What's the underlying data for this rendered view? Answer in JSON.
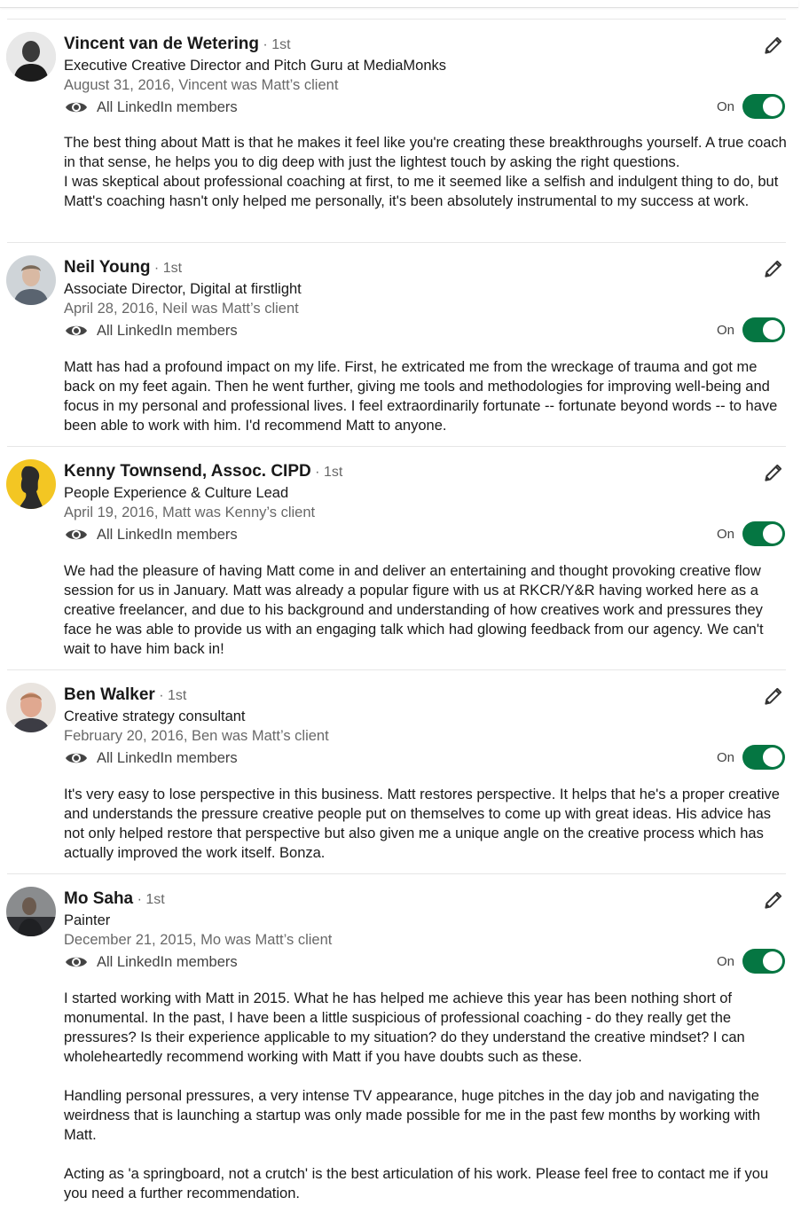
{
  "recommendations": [
    {
      "name": "Vincent van de Wetering",
      "degree": "· 1st",
      "headline": "Executive Creative Director and Pitch Guru at MediaMonks",
      "meta": "August 31, 2016, Vincent was Matt’s client",
      "visibility": "All LinkedIn members",
      "toggle_label": "On",
      "paragraphs": [
        "The best thing about Matt is that he makes it feel like you're creating these breakthroughs yourself. A true coach in that sense, he helps you to dig deep with just the lightest touch by asking the right questions.",
        "I was skeptical about professional coaching at first, to me it seemed like a selfish and indulgent thing to do, but Matt's coaching hasn't only helped me personally, it's been absolutely instrumental to my success at work."
      ]
    },
    {
      "name": "Neil Young",
      "degree": "· 1st",
      "headline": "Associate Director, Digital at firstlight",
      "meta": "April 28, 2016, Neil was Matt’s client",
      "visibility": "All LinkedIn members",
      "toggle_label": "On",
      "paragraphs": [
        "Matt has had a profound impact on my life. First, he extricated me from the wreckage of trauma and got me back on my feet again. Then he went further, giving me tools and methodologies for improving well-being and focus in my personal and professional lives. I feel extraordinarily fortunate -- fortunate beyond words -- to have been able to work with him. I'd recommend Matt to anyone."
      ]
    },
    {
      "name": "Kenny Townsend, Assoc. CIPD",
      "degree": "· 1st",
      "headline": "People Experience & Culture Lead",
      "meta": "April 19, 2016, Matt was Kenny’s client",
      "visibility": "All LinkedIn members",
      "toggle_label": "On",
      "paragraphs": [
        "We had the pleasure of having Matt come in and deliver an entertaining and thought provoking creative flow session for us in January. Matt was already a popular figure with us at RKCR/Y&R having worked here as a creative freelancer, and due to his background and understanding of how creatives work and pressures they face he was able to provide us with an engaging talk which had glowing feedback from our agency. We can't wait to have him back in!"
      ]
    },
    {
      "name": "Ben Walker",
      "degree": "· 1st",
      "headline": "Creative strategy consultant",
      "meta": "February 20, 2016, Ben was Matt’s client",
      "visibility": "All LinkedIn members",
      "toggle_label": "On",
      "paragraphs": [
        "It's very easy to lose perspective in this business. Matt restores perspective. It helps that he's a proper creative and understands the pressure creative people put on themselves to come up with great ideas. His advice has not only helped restore that perspective but also given me a unique angle on the creative process which has actually improved the work itself. Bonza."
      ]
    },
    {
      "name": "Mo Saha",
      "degree": "· 1st",
      "headline": "Painter",
      "meta": "December 21, 2015, Mo was Matt’s client",
      "visibility": "All LinkedIn members",
      "toggle_label": "On",
      "paragraphs": [
        "I started working with Matt in 2015. What he has helped me achieve this year has been nothing short of monumental. In the past, I have been a little suspicious of professional coaching - do they really get the pressures? Is their experience applicable to my situation? do they understand the creative mindset? I can wholeheartedly recommend working with Matt if you have doubts such as these.",
        "Handling personal pressures, a very intense TV appearance, huge pitches in the day job and navigating the weirdness that is launching a startup was only made possible for me in the past few months by working with Matt.",
        "Acting as 'a springboard, not a crutch' is the best articulation of his work. Please feel free to contact me if you you need a further recommendation."
      ]
    }
  ],
  "colors": {
    "toggle_on": "#057642",
    "meta_text": "#666666",
    "divider": "#e6e6e6"
  },
  "icons": {
    "visibility": "eye-icon",
    "edit": "pencil-icon"
  }
}
